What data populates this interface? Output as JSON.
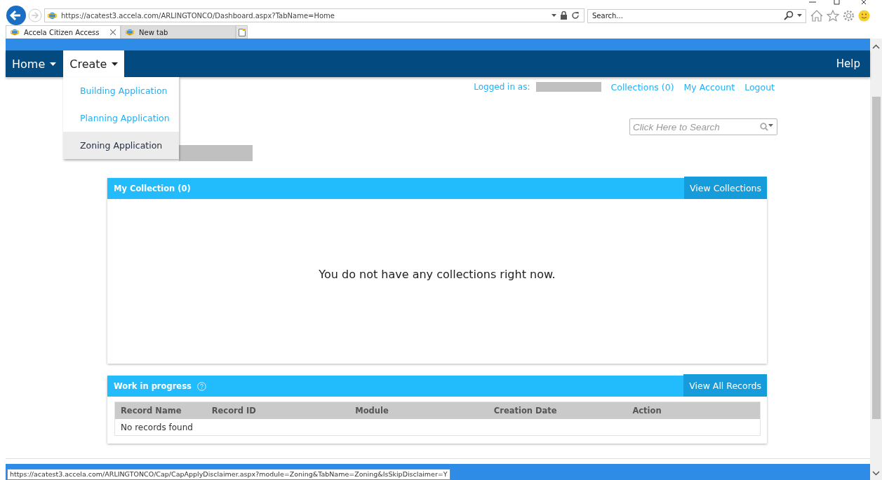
{
  "browser": {
    "address": "https://acatest3.accela.com/ARLINGTONCO/Dashboard.aspx?TabName=Home",
    "search_placeholder": "Search...",
    "tabs": [
      {
        "label": "Accela Citizen Access",
        "selected": true,
        "closable": true
      },
      {
        "label": "New tab",
        "selected": false,
        "closable": false
      }
    ],
    "status_url": "https://acatest3.accela.com/ARLINGTONCO/Cap/CapApplyDisclaimer.aspx?module=Zoning&TabName=Zoning&IsSkipDisclaimer=Y"
  },
  "nav": {
    "items": [
      {
        "label": "Home",
        "selected": false
      },
      {
        "label": "Create",
        "selected": true
      }
    ],
    "help": "Help"
  },
  "create_menu": [
    {
      "label": "Building Application",
      "selected": false
    },
    {
      "label": "Planning Application",
      "selected": false
    },
    {
      "label": "Zoning Application",
      "selected": true
    }
  ],
  "account": {
    "logged_in_label": "Logged in as:",
    "links": [
      "Collections (0)",
      "My Account",
      "Logout"
    ]
  },
  "site_search": {
    "placeholder": "Click Here to Search"
  },
  "collection": {
    "title": "My Collection (0)",
    "button": "View Collections",
    "empty_message": "You do not have any collections right now."
  },
  "work_in_progress": {
    "title": "Work in progress",
    "button": "View All Records",
    "columns": [
      "Record Name",
      "Record ID",
      "Module",
      "Creation Date",
      "Action"
    ],
    "empty_message": "No records found"
  }
}
